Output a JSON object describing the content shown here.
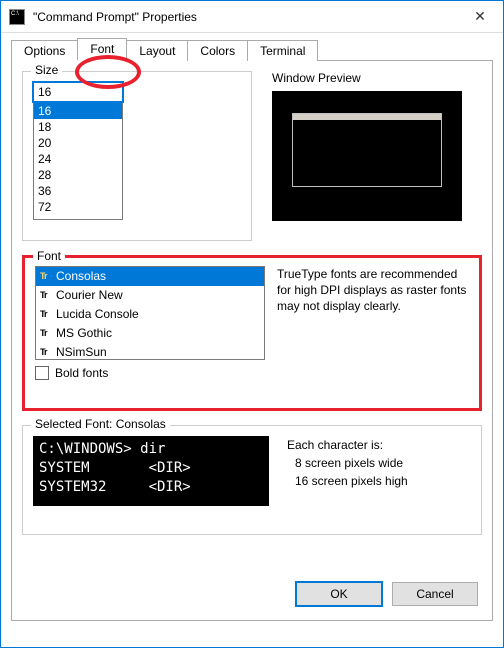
{
  "window": {
    "title": "\"Command Prompt\" Properties",
    "close_glyph": "✕"
  },
  "tabs": {
    "options": "Options",
    "font": "Font",
    "layout": "Layout",
    "colors": "Colors",
    "terminal": "Terminal",
    "active": "font"
  },
  "size": {
    "title": "Size",
    "value": "16",
    "items": [
      "16",
      "18",
      "20",
      "24",
      "28",
      "36",
      "72"
    ],
    "selected": "16"
  },
  "preview": {
    "label": "Window Preview"
  },
  "font": {
    "title": "Font",
    "items": [
      {
        "name": "Consolas",
        "selected": true
      },
      {
        "name": "Courier New",
        "selected": false
      },
      {
        "name": "Lucida Console",
        "selected": false
      },
      {
        "name": "MS Gothic",
        "selected": false
      },
      {
        "name": "NSimSun",
        "selected": false
      }
    ],
    "description": "TrueType fonts are recommended for high DPI displays as raster fonts may not display clearly.",
    "bold_label": "Bold fonts",
    "bold_checked": false
  },
  "selected_font": {
    "title": "Selected Font: Consolas",
    "sample_line1": "C:\\WINDOWS> dir",
    "sample_line2": "SYSTEM       <DIR>",
    "sample_line3": "SYSTEM32     <DIR>",
    "char_intro": "Each character is:",
    "char_wide": "  8 screen pixels wide",
    "char_high": "16 screen pixels high"
  },
  "buttons": {
    "ok": "OK",
    "cancel": "Cancel"
  }
}
